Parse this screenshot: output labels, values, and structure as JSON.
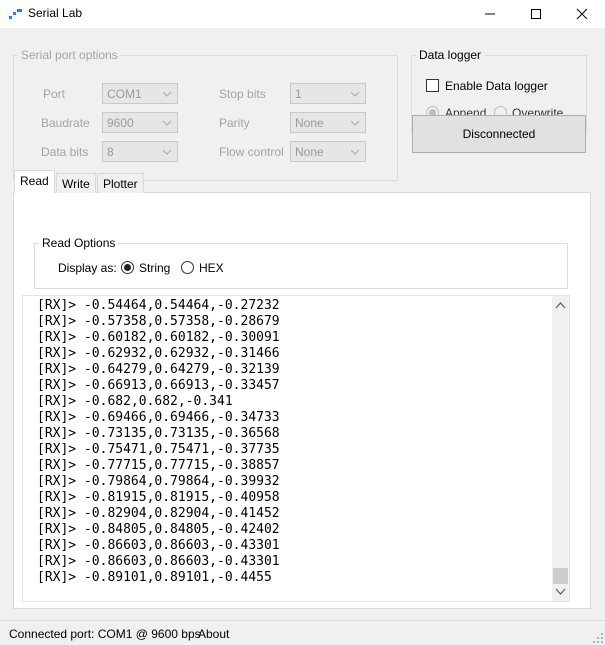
{
  "window": {
    "title": "Serial Lab"
  },
  "serial_options": {
    "title": "Serial port options",
    "port": {
      "label": "Port",
      "value": "COM1"
    },
    "baudrate": {
      "label": "Baudrate",
      "value": "9600"
    },
    "data_bits": {
      "label": "Data bits",
      "value": "8"
    },
    "stop_bits": {
      "label": "Stop bits",
      "value": "1"
    },
    "parity": {
      "label": "Parity",
      "value": "None"
    },
    "flow_control": {
      "label": "Flow control",
      "value": "None"
    }
  },
  "data_logger": {
    "title": "Data logger",
    "enable_label": "Enable Data logger",
    "append_label": "Append",
    "overwrite_label": "Overwrite"
  },
  "connection_button": {
    "label": "Disconnected"
  },
  "tabs": [
    {
      "label": "Read"
    },
    {
      "label": "Write"
    },
    {
      "label": "Plotter"
    }
  ],
  "read_options": {
    "title": "Read Options",
    "display_as_label": "Display as:",
    "string_label": "String",
    "hex_label": "HEX"
  },
  "log_lines": [
    "[RX]> -0.54464,0.54464,-0.27232",
    "[RX]> -0.57358,0.57358,-0.28679",
    "[RX]> -0.60182,0.60182,-0.30091",
    "[RX]> -0.62932,0.62932,-0.31466",
    "[RX]> -0.64279,0.64279,-0.32139",
    "[RX]> -0.66913,0.66913,-0.33457",
    "[RX]> -0.682,0.682,-0.341",
    "[RX]> -0.69466,0.69466,-0.34733",
    "[RX]> -0.73135,0.73135,-0.36568",
    "[RX]> -0.75471,0.75471,-0.37735",
    "[RX]> -0.77715,0.77715,-0.38857",
    "[RX]> -0.79864,0.79864,-0.39932",
    "[RX]> -0.81915,0.81915,-0.40958",
    "[RX]> -0.82904,0.82904,-0.41452",
    "[RX]> -0.84805,0.84805,-0.42402",
    "[RX]> -0.86603,0.86603,-0.43301",
    "[RX]> -0.86603,0.86603,-0.43301",
    "[RX]> -0.89101,0.89101,-0.4455"
  ],
  "status": {
    "connected_text": "Connected port: COM1 @ 9600 bps",
    "about_label": "About"
  }
}
